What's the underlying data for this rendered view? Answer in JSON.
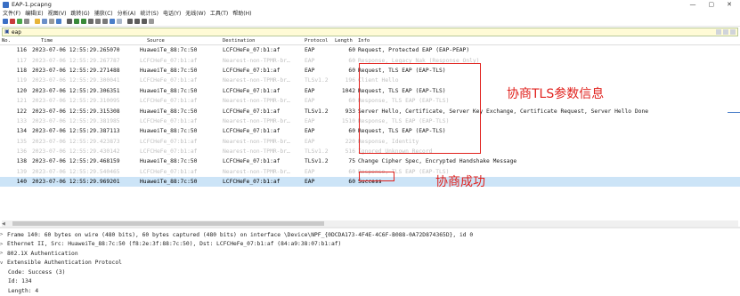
{
  "window": {
    "title": "EAP-1.pcapng",
    "controls": [
      "—",
      "▢",
      "✕"
    ]
  },
  "menu": [
    "文件(F)",
    "编辑(E)",
    "视图(V)",
    "跳转(G)",
    "捕获(C)",
    "分析(A)",
    "统计(S)",
    "电话(Y)",
    "无线(W)",
    "工具(T)",
    "帮助(H)"
  ],
  "filter": {
    "value": "eap"
  },
  "columns": [
    "No.",
    "Time",
    "Source",
    "Destination",
    "Protocol",
    "Length",
    "Info"
  ],
  "packets": [
    {
      "no": "116",
      "time": "2023-07-06 12:55:29.265070",
      "src": "HuaweiTe_88:7c:50",
      "dst": "LCFCHeFe_07:b1:af",
      "proto": "EAP",
      "len": "60",
      "info": "Request, Protected EAP (EAP-PEAP)",
      "style": "norm"
    },
    {
      "no": "117",
      "time": "2023-07-06 12:55:29.267787",
      "src": "LCFCHeFe_07:b1:af",
      "dst": "Nearest-non-TPMR-br…",
      "proto": "EAP",
      "len": "60",
      "info": "Response, Legacy Nak (Response Only)",
      "style": "pale"
    },
    {
      "no": "118",
      "time": "2023-07-06 12:55:29.271488",
      "src": "HuaweiTe_88:7c:50",
      "dst": "LCFCHeFe_07:b1:af",
      "proto": "EAP",
      "len": "60",
      "info": "Request, TLS EAP (EAP-TLS)",
      "style": "norm"
    },
    {
      "no": "119",
      "time": "2023-07-06 12:55:29.300041",
      "src": "LCFCHeFe_07:b1:af",
      "dst": "Nearest-non-TPMR-br…",
      "proto": "TLSv1.2",
      "len": "196",
      "info": "Client Hello",
      "style": "pale"
    },
    {
      "no": "120",
      "time": "2023-07-06 12:55:29.306351",
      "src": "HuaweiTe_88:7c:50",
      "dst": "LCFCHeFe_07:b1:af",
      "proto": "EAP",
      "len": "1042",
      "info": "Request, TLS EAP (EAP-TLS)",
      "style": "norm"
    },
    {
      "no": "121",
      "time": "2023-07-06 12:55:29.310095",
      "src": "LCFCHeFe_07:b1:af",
      "dst": "Nearest-non-TPMR-br…",
      "proto": "EAP",
      "len": "60",
      "info": "Response, TLS EAP (EAP-TLS)",
      "style": "pale"
    },
    {
      "no": "122",
      "time": "2023-07-06 12:55:29.315308",
      "src": "HuaweiTe_88:7c:50",
      "dst": "LCFCHeFe_07:b1:af",
      "proto": "TLSv1.2",
      "len": "933",
      "info": "Server Hello, Certificate, Server Key Exchange, Certificate Request, Server Hello Done",
      "style": "norm"
    },
    {
      "no": "133",
      "time": "2023-07-06 12:55:29.381985",
      "src": "LCFCHeFe_07:b1:af",
      "dst": "Nearest-non-TPMR-br…",
      "proto": "EAP",
      "len": "1510",
      "info": "Response, TLS EAP (EAP-TLS)",
      "style": "pale"
    },
    {
      "no": "134",
      "time": "2023-07-06 12:55:29.387113",
      "src": "HuaweiTe_88:7c:50",
      "dst": "LCFCHeFe_07:b1:af",
      "proto": "EAP",
      "len": "60",
      "info": "Request, TLS EAP (EAP-TLS)",
      "style": "norm"
    },
    {
      "no": "135",
      "time": "2023-07-06 12:55:29.423873",
      "src": "LCFCHeFe_07:b1:af",
      "dst": "Nearest-non-TPMR-br…",
      "proto": "EAP",
      "len": "220",
      "info": "Response, Identity",
      "style": "pale"
    },
    {
      "no": "136",
      "time": "2023-07-06 12:55:29.430142",
      "src": "LCFCHeFe_07:b1:af",
      "dst": "Nearest-non-TPMR-br…",
      "proto": "TLSv1.2",
      "len": "516",
      "info": "Ignored Unknown Record",
      "style": "pale"
    },
    {
      "no": "138",
      "time": "2023-07-06 12:55:29.468159",
      "src": "HuaweiTe_88:7c:50",
      "dst": "LCFCHeFe_07:b1:af",
      "proto": "TLSv1.2",
      "len": "75",
      "info": "Change Cipher Spec, Encrypted Handshake Message",
      "style": "norm"
    },
    {
      "no": "139",
      "time": "2023-07-06 12:55:29.540465",
      "src": "LCFCHeFe_07:b1:af",
      "dst": "Nearest-non-TPMR-br…",
      "proto": "EAP",
      "len": "60",
      "info": "Response, TLS EAP (EAP-TLS)",
      "style": "pale"
    },
    {
      "no": "140",
      "time": "2023-07-06 12:55:29.969201",
      "src": "HuaweiTe_88:7c:50",
      "dst": "LCFCHeFe_07:b1:af",
      "proto": "EAP",
      "len": "60",
      "info": "Success",
      "style": "sel"
    }
  ],
  "details": [
    {
      "arrow": ">",
      "text": "Frame 140: 60 bytes on wire (480 bits), 60 bytes captured (480 bits) on interface \\Device\\NPF_{0DCDA173-4F4E-4C6F-B088-0A72D874365D}, id 0",
      "indent": false
    },
    {
      "arrow": ">",
      "text": "Ethernet II, Src: HuaweiTe_88:7c:50 (f8:2e:3f:88:7c:50), Dst: LCFCHeFe_07:b1:af (84:a9:38:07:b1:af)",
      "indent": false
    },
    {
      "arrow": ">",
      "text": "802.1X Authentication",
      "indent": false
    },
    {
      "arrow": "v",
      "text": "Extensible Authentication Protocol",
      "indent": false
    },
    {
      "arrow": "",
      "text": "Code: Success (3)",
      "indent": true
    },
    {
      "arrow": "",
      "text": "Id: 134",
      "indent": true
    },
    {
      "arrow": "",
      "text": "Length: 4",
      "indent": true
    }
  ],
  "annotations": {
    "tls_label": "协商TLS参数信息",
    "success_label": "协商成功",
    "color": "#e0211d"
  }
}
